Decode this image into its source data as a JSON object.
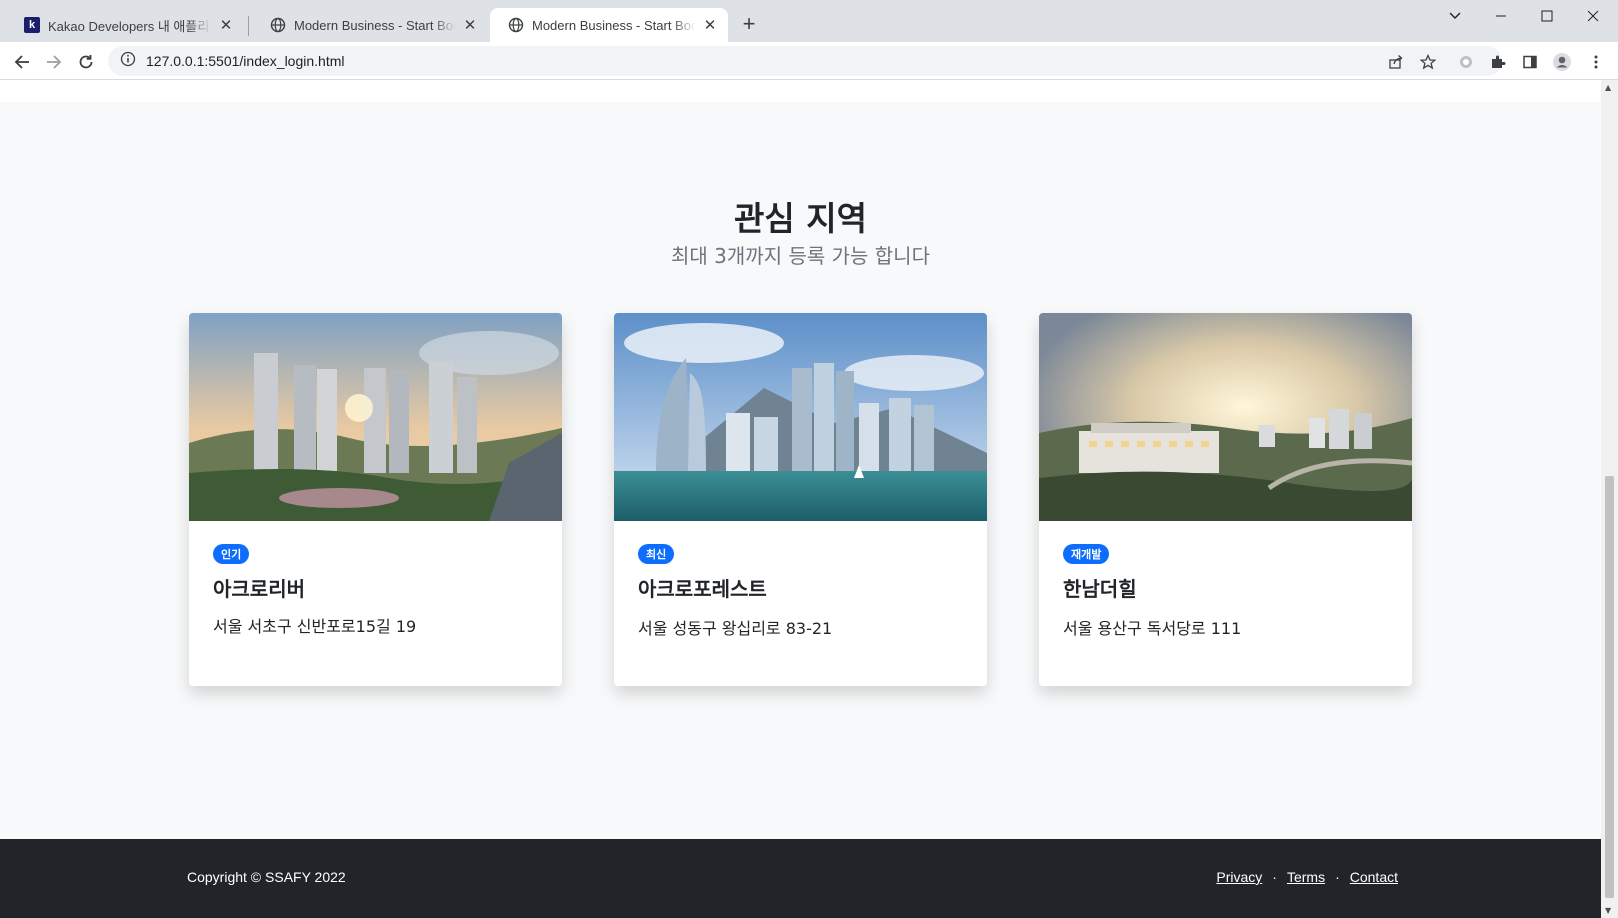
{
  "browser": {
    "tabs": [
      {
        "title": "Kakao Developers 내 애플리케이션",
        "favicon": "kakao-k-icon",
        "favicon_text": "k",
        "active": false
      },
      {
        "title": "Modern Business - Start Bootstrap",
        "favicon": "globe-icon",
        "active": false
      },
      {
        "title": "Modern Business - Start Bootstrap",
        "favicon": "globe-icon",
        "active": true
      }
    ],
    "close_glyph": "✕",
    "newtab_glyph": "+",
    "url": "127.0.0.1:5501/index_login.html"
  },
  "section": {
    "heading": "관심 지역",
    "subheading": "최대 3개까지 등록 가능 합니다"
  },
  "cards": [
    {
      "badge": "인기",
      "title": "아크로리버",
      "address": "서울 서초구 신반포로15길 19"
    },
    {
      "badge": "최신",
      "title": "아크로포레스트",
      "address": "서울 성동구 왕십리로 83-21"
    },
    {
      "badge": "재개발",
      "title": "한남더힐",
      "address": "서울 용산구 독서당로 111"
    }
  ],
  "footer": {
    "copyright": "Copyright © SSAFY 2022",
    "links": [
      "Privacy",
      "Terms",
      "Contact"
    ],
    "separator": "·"
  },
  "colors": {
    "badge": "#0d6efd",
    "footer_bg": "#212529",
    "page_bg": "#f8f9fa"
  }
}
